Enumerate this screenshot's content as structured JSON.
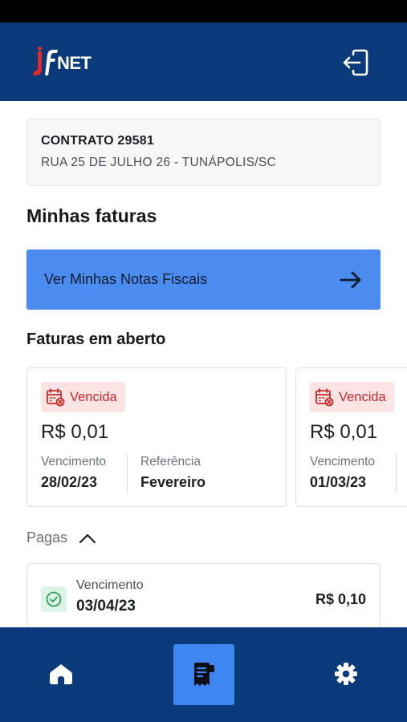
{
  "app": {
    "logo_text": "jfNET"
  },
  "header": {
    "logout_icon": "logout-icon"
  },
  "contract": {
    "title": "CONTRATO 29581",
    "address": "RUA 25 DE JULHO 26 - TUNÁPOLIS/SC"
  },
  "sections": {
    "minhas_faturas": "Minhas faturas",
    "faturas_aberto": "Faturas em aberto",
    "pagas": "Pagas"
  },
  "notas_button": {
    "label": "Ver Minhas Notas Fiscais",
    "icon": "arrow-right-icon"
  },
  "open_invoices": [
    {
      "status": "Vencida",
      "amount": "R$ 0,01",
      "due_label": "Vencimento",
      "due_date": "28/02/23",
      "ref_label": "Referência",
      "ref_value": "Fevereiro"
    },
    {
      "status": "Vencida",
      "amount": "R$ 0,01",
      "due_label": "Vencimento",
      "due_date": "01/03/23"
    }
  ],
  "paid_invoices": [
    {
      "due_label": "Vencimento",
      "due_date": "03/04/23",
      "amount": "R$ 0,10"
    }
  ],
  "bottom_nav": {
    "items": [
      {
        "name": "home",
        "icon": "home-icon",
        "active": false
      },
      {
        "name": "faturas",
        "icon": "receipt-icon",
        "active": true
      },
      {
        "name": "settings",
        "icon": "gear-icon",
        "active": false
      }
    ]
  },
  "colors": {
    "brand_navy": "#0b3a7a",
    "accent_blue": "#4a8cf0",
    "overdue_red": "#c92a2a",
    "overdue_bg": "#fde4e4",
    "paid_green": "#2f9e5a",
    "paid_bg": "#dcf5e6"
  }
}
